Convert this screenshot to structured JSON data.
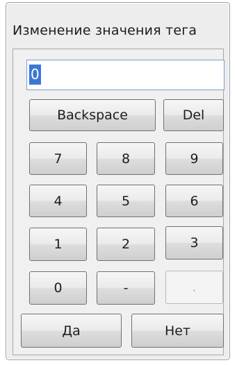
{
  "dialog": {
    "title": "Изменение значения тега",
    "value": "0"
  },
  "keys": {
    "backspace": "Backspace",
    "del": "Del",
    "k7": "7",
    "k8": "8",
    "k9": "9",
    "k4": "4",
    "k5": "5",
    "k6": "6",
    "k1": "1",
    "k2": "2",
    "k3": "3",
    "k0": "0",
    "minus": "-",
    "dot": "."
  },
  "actions": {
    "yes": "Да",
    "no": "Нет"
  }
}
